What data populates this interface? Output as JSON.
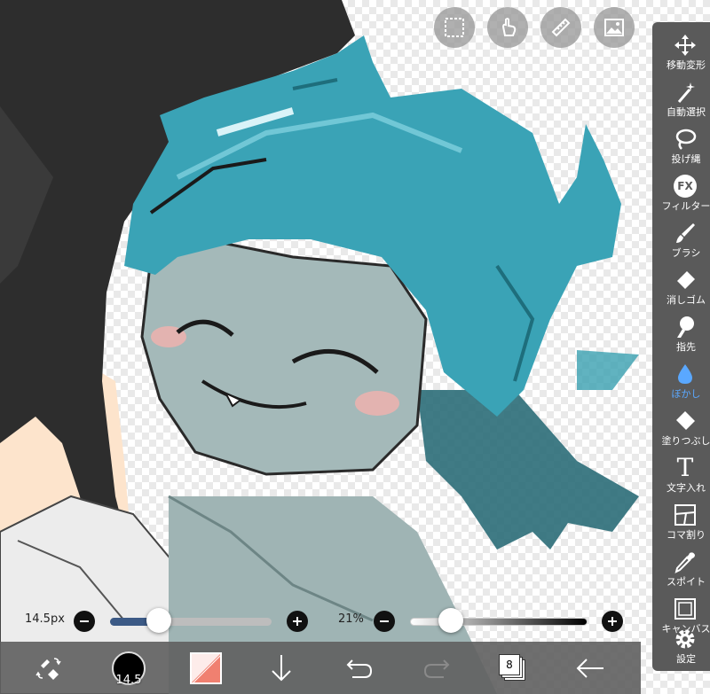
{
  "quick_tools": [
    {
      "name": "selection-icon"
    },
    {
      "name": "touch-icon"
    },
    {
      "name": "ruler-icon"
    },
    {
      "name": "image-icon"
    }
  ],
  "toolbar": {
    "items": [
      {
        "label": "移動変形",
        "icon": "move-icon"
      },
      {
        "label": "自動選択",
        "icon": "magic-wand-icon"
      },
      {
        "label": "投げ縄",
        "icon": "lasso-icon"
      },
      {
        "label": "フィルター",
        "icon": "fx-icon",
        "icon_text": "FX"
      },
      {
        "label": "ブラシ",
        "icon": "brush-icon"
      },
      {
        "label": "消しゴム",
        "icon": "eraser-icon"
      },
      {
        "label": "指先",
        "icon": "finger-icon"
      },
      {
        "label": "ぼかし",
        "icon": "blur-drop-icon",
        "active": true
      },
      {
        "label": "塗りつぶし",
        "icon": "bucket-icon"
      },
      {
        "label": "文字入れ",
        "icon": "text-icon",
        "icon_text": "T"
      },
      {
        "label": "コマ割り",
        "icon": "frame-divider-icon"
      },
      {
        "label": "スポイト",
        "icon": "eyedropper-icon"
      },
      {
        "label": "キャンバス",
        "icon": "canvas-icon"
      },
      {
        "label": "設定",
        "icon": "gear-icon"
      }
    ]
  },
  "brush_size": {
    "label": "14.5px",
    "value_fraction": 0.35
  },
  "opacity": {
    "label": "21%",
    "value_fraction": 0.21
  },
  "bottom_bar": {
    "color_size_label": "14.5",
    "layer_count": "8"
  },
  "colors": {
    "toolbar_bg": "#5a5a5a",
    "active_tool": "#5aa8ff",
    "secondary_color": "#f08070",
    "size_track": "#3c5a86"
  }
}
